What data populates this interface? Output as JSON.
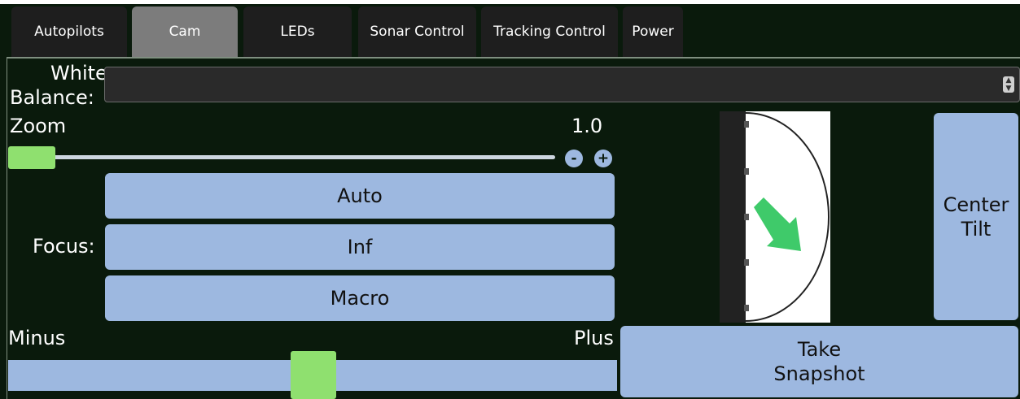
{
  "tabs": [
    {
      "label": "Autopilots",
      "active": false
    },
    {
      "label": "Cam",
      "active": true
    },
    {
      "label": "LEDs",
      "active": false
    },
    {
      "label": "Sonar Control",
      "active": false
    },
    {
      "label": "Tracking Control",
      "active": false
    },
    {
      "label": "Power",
      "active": false
    }
  ],
  "white_balance": {
    "label_line1": "White",
    "label_line2": "Balance:",
    "value": ""
  },
  "zoom": {
    "label": "Zoom",
    "value_text": "1.0",
    "slider_fraction": 0.0,
    "minus_label": "-",
    "plus_label": "+"
  },
  "focus": {
    "label": "Focus:",
    "buttons": [
      "Auto",
      "Inf",
      "Macro"
    ]
  },
  "tilt": {
    "indicator_icon": "tilt-arrow-icon",
    "center_label_line1": "Center",
    "center_label_line2": "Tilt"
  },
  "snapshot": {
    "label_line1": "Take",
    "label_line2": "Snapshot"
  },
  "exposure": {
    "min_label": "Minus",
    "max_label": "Plus",
    "slider_fraction": 0.5
  },
  "colors": {
    "background": "#0a1a0c",
    "button": "#9db8e0",
    "handle": "#8fe06f",
    "active_tab": "#7c7c7c",
    "tab": "#1e1e1e"
  }
}
